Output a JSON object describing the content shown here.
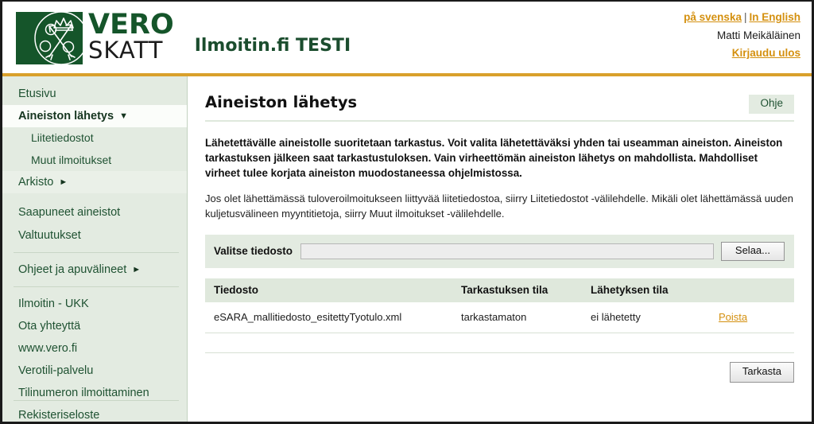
{
  "header": {
    "logo": {
      "mark_icon": "vero-coat-of-arms-icon",
      "word_primary": "VERO",
      "word_secondary": "SKATT"
    },
    "app_title": "Ilmoitin.fi TESTI",
    "lang_swedish": "på svenska",
    "lang_separator": "|",
    "lang_english": "In English",
    "user_name": "Matti Meikäläinen",
    "logout_label": "Kirjaudu ulos",
    "accent_color": "#d9a02b"
  },
  "sidebar": {
    "items": [
      {
        "label": "Etusivu",
        "state": "normal",
        "caret": ""
      },
      {
        "label": "Aineiston lähetys",
        "state": "active",
        "caret": "▼"
      },
      {
        "label": "Liitetiedostot",
        "state": "sub",
        "caret": ""
      },
      {
        "label": "Muut ilmoitukset",
        "state": "sub",
        "caret": ""
      },
      {
        "label": "Arkisto",
        "state": "shaded",
        "caret": "►"
      },
      {
        "label": "Saapuneet aineistot",
        "state": "normal",
        "caret": ""
      },
      {
        "label": "Valtuutukset",
        "state": "normal",
        "caret": ""
      },
      {
        "label": "Ohjeet ja apuvälineet",
        "state": "normal",
        "caret": "►"
      },
      {
        "label": "Ilmoitin - UKK",
        "state": "normal",
        "caret": ""
      },
      {
        "label": "Ota yhteyttä",
        "state": "normal",
        "caret": ""
      },
      {
        "label": "www.vero.fi",
        "state": "normal",
        "caret": ""
      },
      {
        "label": "Verotili-palvelu",
        "state": "normal",
        "caret": ""
      },
      {
        "label": "Tilinumeron ilmoittaminen",
        "state": "normal",
        "caret": ""
      },
      {
        "label": "Rekisteriseloste",
        "state": "normal",
        "caret": ""
      }
    ]
  },
  "main": {
    "page_title": "Aineiston lähetys",
    "help_label": "Ohje",
    "intro_bold": "Lähetettävälle aineistolle suoritetaan tarkastus. Voit valita lähetettäväksi yhden tai useamman aineiston. Aineiston tarkastuksen jälkeen saat tarkastustuloksen. Vain virheettömän aineiston lähetys on mahdollista. Mahdolliset virheet tulee korjata aineiston muodostaneessa ohjelmistossa.",
    "intro_normal": "Jos olet lähettämässä tuloveroilmoitukseen liittyvää liitetiedostoa, siirry Liitetiedostot -välilehdelle. Mikäli olet lähettämässä uuden kuljetusvälineen myyntitietoja, siirry Muut ilmoitukset -välilehdelle.",
    "file_picker": {
      "label": "Valitse tiedosto",
      "value": "",
      "placeholder": "",
      "browse_label": "Selaa..."
    },
    "table": {
      "headers": [
        "Tiedosto",
        "Tarkastuksen tila",
        "Lähetyksen tila",
        ""
      ],
      "rows": [
        {
          "file": "eSARA_mallitiedosto_esitettyTyotulo.xml",
          "check_status": "tarkastamaton",
          "send_status": "ei lähetetty",
          "action": "Poista"
        }
      ]
    },
    "submit_label": "Tarkasta"
  }
}
